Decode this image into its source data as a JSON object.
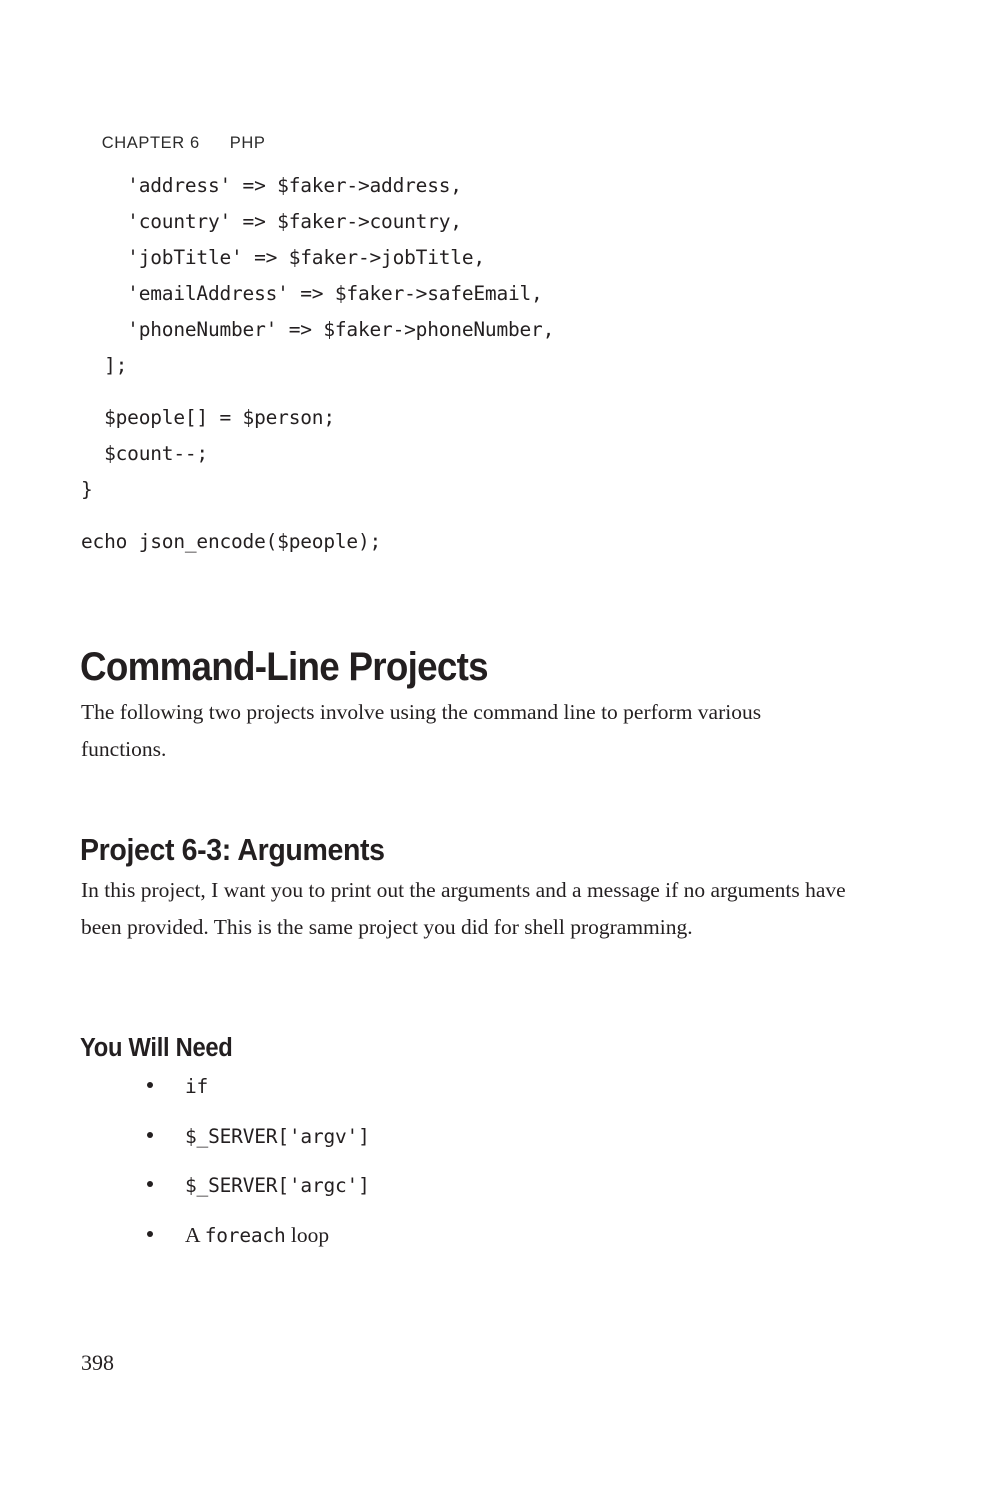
{
  "running_head": {
    "chapter": "CHAPTER 6",
    "title": "PHP"
  },
  "code_block": {
    "lines": [
      "    'address' => $faker->address,",
      "    'country' => $faker->country,",
      "    'jobTitle' => $faker->jobTitle,",
      "    'emailAddress' => $faker->safeEmail,",
      "    'phoneNumber' => $faker->phoneNumber,",
      "  ];",
      "",
      "  $people[] = $person;",
      "  $count--;",
      "}",
      "",
      "echo json_encode($people);"
    ]
  },
  "section": {
    "heading": "Command-Line Projects",
    "intro_paragraph": "The following two projects involve using the command line to perform various functions."
  },
  "project": {
    "heading": "Project 6-3: Arguments",
    "description": "In this project, I want you to print out the arguments and a message if no arguments have been provided. This is the same project you did for shell programming.",
    "requirements_heading": "You Will Need",
    "requirements": [
      {
        "pre": "",
        "code": "if",
        "post": ""
      },
      {
        "pre": "",
        "code": "$_SERVER['argv']",
        "post": ""
      },
      {
        "pre": "",
        "code": "$_SERVER['argc']",
        "post": ""
      },
      {
        "pre": "A ",
        "code": "foreach",
        "post": " loop"
      }
    ]
  },
  "folio": "398",
  "colors": {
    "text": "#231f20",
    "background": "#ffffff"
  }
}
